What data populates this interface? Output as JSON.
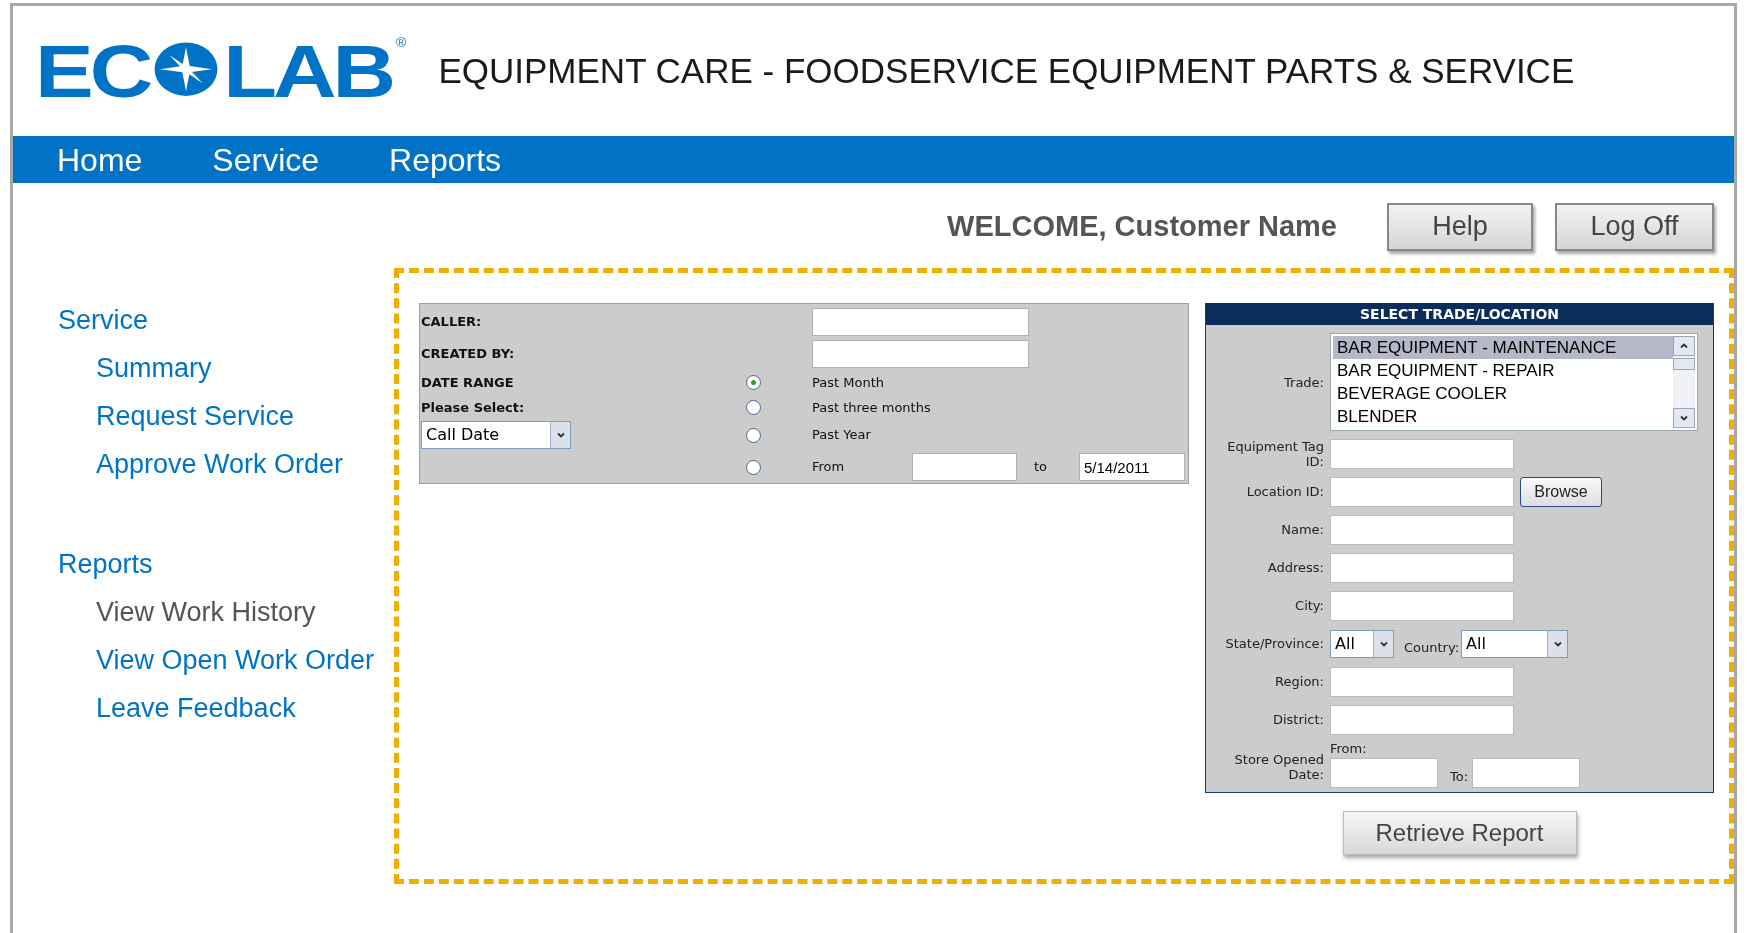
{
  "logo": {
    "left": "EC",
    "right": "LAB",
    "mark": "®"
  },
  "title": "EQUIPMENT CARE - FOODSERVICE EQUIPMENT PARTS & SERVICE",
  "nav": [
    {
      "label": "Home"
    },
    {
      "label": "Service"
    },
    {
      "label": "Reports"
    }
  ],
  "welcome": "WELCOME, Customer Name",
  "header_buttons": [
    "Help",
    "Log Off"
  ],
  "sidebar": [
    {
      "heading": "Service",
      "items": [
        {
          "label": "Summary",
          "selected": false
        },
        {
          "label": "Request Service",
          "selected": false
        },
        {
          "label": "Approve Work Order",
          "selected": false
        }
      ]
    },
    {
      "heading": "Reports",
      "items": [
        {
          "label": "View Work History",
          "selected": true
        },
        {
          "label": "View Open Work Order",
          "selected": false
        },
        {
          "label": "Leave Feedback",
          "selected": false
        }
      ]
    }
  ],
  "search_form": {
    "fields": [
      {
        "label": "CALLER:"
      },
      {
        "label": "CREATED BY:"
      }
    ],
    "date_range_label": "DATE RANGE",
    "select_label": "Please Select:",
    "date_type": "Call Date",
    "ranges": [
      {
        "label": "Past Month",
        "selected": true
      },
      {
        "label": "Past three months",
        "selected": false
      },
      {
        "label": "Past Year",
        "selected": false
      },
      {
        "label": "From",
        "selected": false
      }
    ],
    "to_label": "to",
    "to_value": "5/14/2011"
  },
  "location_panel": {
    "title": "SELECT TRADE/LOCATION",
    "trade_label": "Trade:",
    "trades": [
      {
        "label": "BAR EQUIPMENT - MAINTENANCE",
        "selected": true
      },
      {
        "label": "BAR EQUIPMENT - REPAIR",
        "selected": false
      },
      {
        "label": "BEVERAGE COOLER",
        "selected": false
      },
      {
        "label": "BLENDER",
        "selected": false
      }
    ],
    "fields": [
      {
        "kind": "text",
        "label": "Equipment Tag ID:"
      },
      {
        "kind": "browse",
        "label": "Location ID:",
        "button": "Browse"
      },
      {
        "kind": "text",
        "label": "Name:"
      },
      {
        "kind": "text",
        "label": "Address:"
      },
      {
        "kind": "text",
        "label": "City:"
      },
      {
        "kind": "state",
        "label": "State/Province:",
        "value": "All",
        "country_label": "Country:",
        "country_value": "All"
      },
      {
        "kind": "text",
        "label": "Region:"
      },
      {
        "kind": "text",
        "label": "District:"
      },
      {
        "kind": "dates",
        "label": "Store Opened Date:",
        "from_label": "From:",
        "to_label": "To:"
      }
    ]
  },
  "submit": "Retrieve Report"
}
